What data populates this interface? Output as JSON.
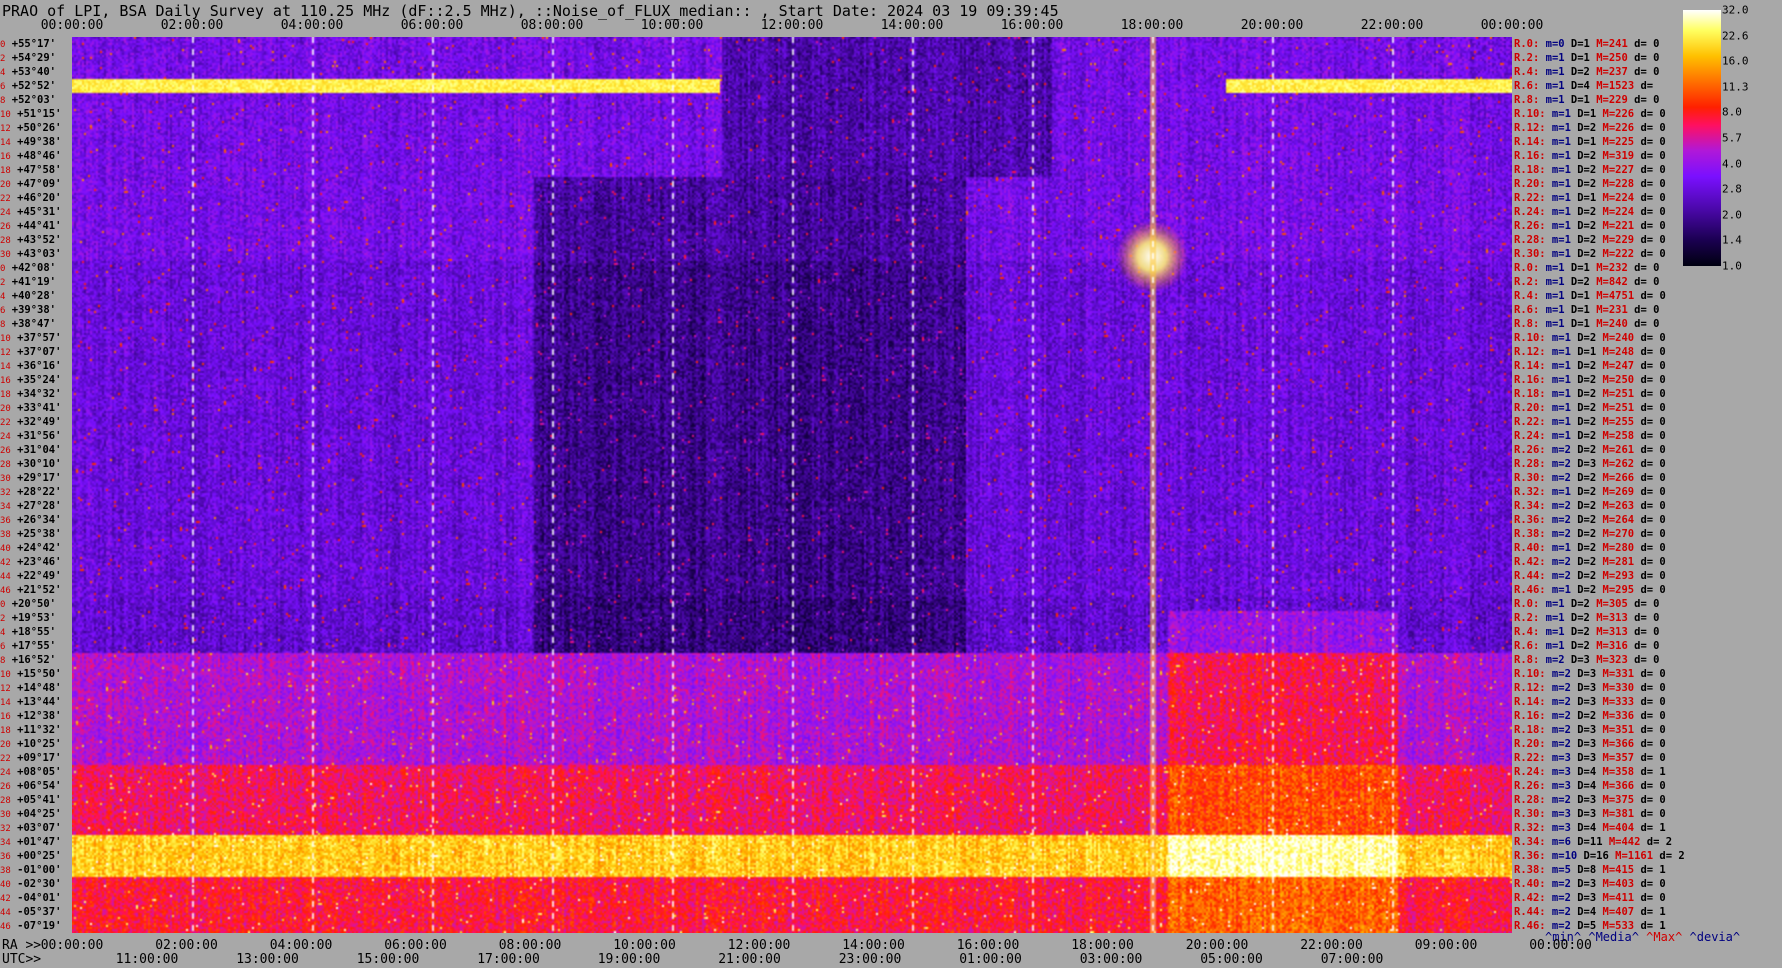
{
  "title": "PRAO of LPI, BSA Daily Survey at 110.25 MHz (dF::2.5 MHz), ::Noise_of_FLUX_median:: , Start Date: 2024 03 19 09:39:45",
  "chart_data": {
    "type": "heatmap",
    "title": "PRAO of LPI, BSA Daily Survey at 110.25 MHz (dF::2.5 MHz), ::Noise_of_FLUX_median:: , Start Date: 2024 03 19 09:39:45",
    "top_ticks": [
      "00:00:00",
      "02:00:00",
      "04:00:00",
      "06:00:00",
      "08:00:00",
      "10:00:00",
      "12:00:00",
      "14:00:00",
      "16:00:00",
      "18:00:00",
      "20:00:00",
      "22:00:00",
      "00:00:00"
    ],
    "ra_prefix": "RA >>",
    "ra_ticks": [
      "00:00:00",
      "02:00:00",
      "04:00:00",
      "06:00:00",
      "08:00:00",
      "10:00:00",
      "12:00:00",
      "14:00:00",
      "16:00:00",
      "18:00:00",
      "20:00:00",
      "22:00:00",
      "09:00:00",
      "00:00:00"
    ],
    "utc_prefix": "UTC>>",
    "utc_ticks": [
      "11:00:00",
      "13:00:00",
      "15:00:00",
      "17:00:00",
      "19:00:00",
      "21:00:00",
      "23:00:00",
      "01:00:00",
      "03:00:00",
      "05:00:00",
      "07:00:00"
    ],
    "dec_labels": [
      "+55°17'",
      "+54°29'",
      "+53°40'",
      "+52°52'",
      "+52°03'",
      "+51°15'",
      "+50°26'",
      "+49°38'",
      "+48°46'",
      "+47°58'",
      "+47°09'",
      "+46°20'",
      "+45°31'",
      "+44°41'",
      "+43°52'",
      "+43°03'",
      "+42°08'",
      "+41°19'",
      "+40°28'",
      "+39°38'",
      "+38°47'",
      "+37°57'",
      "+37°07'",
      "+36°16'",
      "+35°24'",
      "+34°32'",
      "+33°41'",
      "+32°49'",
      "+31°56'",
      "+31°04'",
      "+30°10'",
      "+29°17'",
      "+28°22'",
      "+27°28'",
      "+26°34'",
      "+25°38'",
      "+24°42'",
      "+23°46'",
      "+22°49'",
      "+21°52'",
      "+20°50'",
      "+19°53'",
      "+18°55'",
      "+17°55'",
      "+16°52'",
      "+15°50'",
      "+14°48'",
      "+13°44'",
      "+12°38'",
      "+11°32'",
      "+10°25'",
      "+09°17'",
      "+08°05'",
      "+06°54'",
      "+05°41'",
      "+04°25'",
      "+03°07'",
      "+01°47'",
      "+00°25'",
      "-01°00'",
      "-02°30'",
      "-04°01'",
      "-05°37'",
      "-07°19'"
    ],
    "dec_index": [
      "0",
      "2",
      "4",
      "6",
      "8",
      "10",
      "12",
      "14",
      "16",
      "18",
      "20",
      "22",
      "24",
      "26",
      "28",
      "30",
      "0",
      "2",
      "4",
      "6",
      "8",
      "10",
      "12",
      "14",
      "16",
      "18",
      "20",
      "22",
      "24",
      "26",
      "28",
      "30",
      "32",
      "34",
      "36",
      "38",
      "40",
      "42",
      "44",
      "46",
      "0",
      "2",
      "4",
      "6",
      "8",
      "10",
      "12",
      "14",
      "16",
      "18",
      "20",
      "22",
      "24",
      "26",
      "28",
      "30",
      "32",
      "34",
      "36",
      "38",
      "40",
      "42",
      "44",
      "46"
    ],
    "rows": [
      {
        "r": "R.0:",
        "m": "0",
        "D": "1",
        "M": "241",
        "d": "0"
      },
      {
        "r": "R.2:",
        "m": "1",
        "D": "1",
        "M": "250",
        "d": "0"
      },
      {
        "r": "R.4:",
        "m": "1",
        "D": "2",
        "M": "237",
        "d": "0"
      },
      {
        "r": "R.6:",
        "m": "1",
        "D": "4",
        "M": "1523",
        "d": ""
      },
      {
        "r": "R.8:",
        "m": "1",
        "D": "1",
        "M": "229",
        "d": "0"
      },
      {
        "r": "R.10:",
        "m": "1",
        "D": "1",
        "M": "226",
        "d": "0"
      },
      {
        "r": "R.12:",
        "m": "1",
        "D": "2",
        "M": "226",
        "d": "0"
      },
      {
        "r": "R.14:",
        "m": "1",
        "D": "1",
        "M": "225",
        "d": "0"
      },
      {
        "r": "R.16:",
        "m": "1",
        "D": "2",
        "M": "319",
        "d": "0"
      },
      {
        "r": "R.18:",
        "m": "1",
        "D": "2",
        "M": "227",
        "d": "0"
      },
      {
        "r": "R.20:",
        "m": "1",
        "D": "2",
        "M": "228",
        "d": "0"
      },
      {
        "r": "R.22:",
        "m": "1",
        "D": "1",
        "M": "224",
        "d": "0"
      },
      {
        "r": "R.24:",
        "m": "1",
        "D": "2",
        "M": "224",
        "d": "0"
      },
      {
        "r": "R.26:",
        "m": "1",
        "D": "2",
        "M": "221",
        "d": "0"
      },
      {
        "r": "R.28:",
        "m": "1",
        "D": "2",
        "M": "229",
        "d": "0"
      },
      {
        "r": "R.30:",
        "m": "1",
        "D": "2",
        "M": "222",
        "d": "0"
      },
      {
        "r": "R.0:",
        "m": "1",
        "D": "1",
        "M": "232",
        "d": "0"
      },
      {
        "r": "R.2:",
        "m": "1",
        "D": "2",
        "M": "842",
        "d": "0"
      },
      {
        "r": "R.4:",
        "m": "1",
        "D": "1",
        "M": "4751",
        "d": "0"
      },
      {
        "r": "R.6:",
        "m": "1",
        "D": "1",
        "M": "231",
        "d": "0"
      },
      {
        "r": "R.8:",
        "m": "1",
        "D": "1",
        "M": "240",
        "d": "0"
      },
      {
        "r": "R.10:",
        "m": "1",
        "D": "2",
        "M": "240",
        "d": "0"
      },
      {
        "r": "R.12:",
        "m": "1",
        "D": "1",
        "M": "248",
        "d": "0"
      },
      {
        "r": "R.14:",
        "m": "1",
        "D": "2",
        "M": "247",
        "d": "0"
      },
      {
        "r": "R.16:",
        "m": "1",
        "D": "2",
        "M": "250",
        "d": "0"
      },
      {
        "r": "R.18:",
        "m": "1",
        "D": "2",
        "M": "251",
        "d": "0"
      },
      {
        "r": "R.20:",
        "m": "1",
        "D": "2",
        "M": "251",
        "d": "0"
      },
      {
        "r": "R.22:",
        "m": "1",
        "D": "2",
        "M": "255",
        "d": "0"
      },
      {
        "r": "R.24:",
        "m": "1",
        "D": "2",
        "M": "258",
        "d": "0"
      },
      {
        "r": "R.26:",
        "m": "2",
        "D": "2",
        "M": "261",
        "d": "0"
      },
      {
        "r": "R.28:",
        "m": "2",
        "D": "3",
        "M": "262",
        "d": "0"
      },
      {
        "r": "R.30:",
        "m": "2",
        "D": "2",
        "M": "266",
        "d": "0"
      },
      {
        "r": "R.32:",
        "m": "1",
        "D": "2",
        "M": "269",
        "d": "0"
      },
      {
        "r": "R.34:",
        "m": "2",
        "D": "2",
        "M": "263",
        "d": "0"
      },
      {
        "r": "R.36:",
        "m": "2",
        "D": "2",
        "M": "264",
        "d": "0"
      },
      {
        "r": "R.38:",
        "m": "2",
        "D": "2",
        "M": "270",
        "d": "0"
      },
      {
        "r": "R.40:",
        "m": "1",
        "D": "2",
        "M": "280",
        "d": "0"
      },
      {
        "r": "R.42:",
        "m": "2",
        "D": "2",
        "M": "281",
        "d": "0"
      },
      {
        "r": "R.44:",
        "m": "2",
        "D": "2",
        "M": "293",
        "d": "0"
      },
      {
        "r": "R.46:",
        "m": "1",
        "D": "2",
        "M": "295",
        "d": "0"
      },
      {
        "r": "R.0:",
        "m": "1",
        "D": "2",
        "M": "305",
        "d": "0"
      },
      {
        "r": "R.2:",
        "m": "1",
        "D": "2",
        "M": "313",
        "d": "0"
      },
      {
        "r": "R.4:",
        "m": "1",
        "D": "2",
        "M": "313",
        "d": "0"
      },
      {
        "r": "R.6:",
        "m": "1",
        "D": "2",
        "M": "316",
        "d": "0"
      },
      {
        "r": "R.8:",
        "m": "2",
        "D": "3",
        "M": "323",
        "d": "0"
      },
      {
        "r": "R.10:",
        "m": "2",
        "D": "3",
        "M": "331",
        "d": "0"
      },
      {
        "r": "R.12:",
        "m": "2",
        "D": "3",
        "M": "330",
        "d": "0"
      },
      {
        "r": "R.14:",
        "m": "2",
        "D": "3",
        "M": "333",
        "d": "0"
      },
      {
        "r": "R.16:",
        "m": "2",
        "D": "2",
        "M": "336",
        "d": "0"
      },
      {
        "r": "R.18:",
        "m": "2",
        "D": "3",
        "M": "351",
        "d": "0"
      },
      {
        "r": "R.20:",
        "m": "2",
        "D": "3",
        "M": "366",
        "d": "0"
      },
      {
        "r": "R.22:",
        "m": "3",
        "D": "3",
        "M": "357",
        "d": "0"
      },
      {
        "r": "R.24:",
        "m": "3",
        "D": "4",
        "M": "358",
        "d": "1"
      },
      {
        "r": "R.26:",
        "m": "3",
        "D": "4",
        "M": "366",
        "d": "0"
      },
      {
        "r": "R.28:",
        "m": "2",
        "D": "3",
        "M": "375",
        "d": "0"
      },
      {
        "r": "R.30:",
        "m": "3",
        "D": "3",
        "M": "381",
        "d": "0"
      },
      {
        "r": "R.32:",
        "m": "3",
        "D": "4",
        "M": "404",
        "d": "1"
      },
      {
        "r": "R.34:",
        "m": "6",
        "D": "11",
        "M": "442",
        "d": "2"
      },
      {
        "r": "R.36:",
        "m": "10",
        "D": "16",
        "M": "1161",
        "d": "2"
      },
      {
        "r": "R.38:",
        "m": "5",
        "D": "8",
        "M": "415",
        "d": "1"
      },
      {
        "r": "R.40:",
        "m": "2",
        "D": "3",
        "M": "403",
        "d": "0"
      },
      {
        "r": "R.42:",
        "m": "2",
        "D": "3",
        "M": "411",
        "d": "0"
      },
      {
        "r": "R.44:",
        "m": "2",
        "D": "4",
        "M": "407",
        "d": "1"
      },
      {
        "r": "R.46:",
        "m": "2",
        "D": "5",
        "M": "533",
        "d": "1"
      }
    ],
    "colorbar_ticks": [
      "32.0",
      "22.6",
      "16.0",
      "11.3",
      "8.0",
      "5.7",
      "4.0",
      "2.8",
      "2.0",
      "1.4",
      "1.0"
    ],
    "footer": {
      "min": "^min^",
      "media": "^Media^",
      "max": "^Max^",
      "devia": "^devia^"
    }
  }
}
